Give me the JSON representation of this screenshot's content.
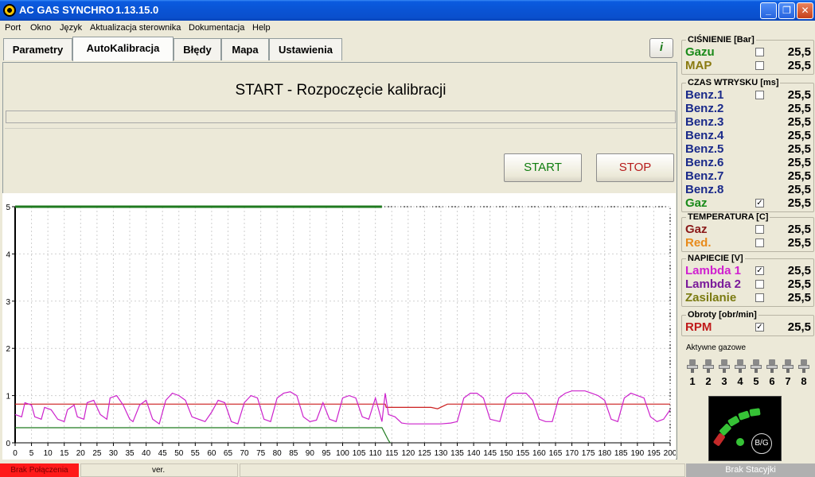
{
  "window": {
    "title": "AC GAS SYNCHRO",
    "version": "1.13.15.0"
  },
  "menu": [
    "Port",
    "Okno",
    "Język",
    "Aktualizacja sterownika",
    "Dokumentacja",
    "Help"
  ],
  "tabs": [
    "Parametry",
    "AutoKalibracja",
    "Błędy",
    "Mapa",
    "Ustawienia"
  ],
  "help_icon": "i",
  "calibration": {
    "title": "START - Rozpoczęcie kalibracji",
    "start": "START",
    "stop": "STOP",
    "progress": 0
  },
  "chart_data": {
    "type": "line",
    "x_ticks": [
      0,
      5,
      10,
      15,
      20,
      25,
      30,
      35,
      40,
      45,
      50,
      55,
      60,
      65,
      70,
      75,
      80,
      85,
      90,
      95,
      100,
      105,
      110,
      115,
      120,
      125,
      130,
      135,
      140,
      145,
      150,
      155,
      160,
      165,
      170,
      175,
      180,
      185,
      190,
      195,
      200
    ],
    "y_ticks": [
      0,
      1,
      2,
      3,
      4,
      5
    ],
    "xlim": [
      0,
      200
    ],
    "ylim": [
      0,
      5
    ],
    "grid": true,
    "series": [
      {
        "color": "#1f7a1f",
        "x": [
          0,
          112
        ],
        "y": [
          5.0,
          5.0
        ]
      },
      {
        "color": "#cc1f1f",
        "x": [
          0,
          113,
          113.3,
          127,
          129,
          132,
          200
        ],
        "y": [
          0.82,
          0.82,
          0.75,
          0.75,
          0.72,
          0.82,
          0.82
        ]
      },
      {
        "color": "#1f7a1f",
        "x": [
          0,
          112,
          114,
          114.5
        ],
        "y": [
          0.32,
          0.32,
          0.05,
          0.0
        ]
      },
      {
        "color": "#cc22cc",
        "x": [
          0,
          2,
          3,
          5,
          6,
          8,
          9,
          11,
          13,
          15,
          16,
          18,
          19,
          21,
          22,
          24,
          26,
          28,
          29,
          31,
          33,
          35,
          36,
          38,
          40,
          42,
          44,
          46,
          48,
          50,
          52,
          54,
          56,
          58,
          60,
          62,
          64,
          66,
          68,
          70,
          72,
          74,
          76,
          78,
          80,
          82,
          84,
          86,
          88,
          90,
          92,
          94,
          96,
          98,
          100,
          102,
          104,
          106,
          108,
          110,
          112,
          113,
          114,
          116,
          118,
          120,
          122,
          125,
          128,
          130,
          133,
          135,
          137,
          139,
          141,
          143,
          145,
          148,
          150,
          152,
          154,
          156,
          158,
          160,
          162,
          164,
          166,
          168,
          170,
          172,
          174,
          176,
          178,
          180,
          182,
          184,
          186,
          188,
          190,
          192,
          194,
          196,
          198,
          200
        ],
        "y": [
          0.6,
          0.55,
          0.85,
          0.8,
          0.55,
          0.5,
          0.75,
          0.7,
          0.5,
          0.45,
          0.7,
          0.8,
          0.55,
          0.5,
          0.85,
          0.9,
          0.6,
          0.5,
          0.95,
          1.0,
          0.8,
          0.5,
          0.45,
          0.8,
          0.9,
          0.5,
          0.4,
          0.9,
          1.05,
          1.0,
          0.9,
          0.55,
          0.5,
          0.45,
          0.65,
          0.9,
          0.85,
          0.45,
          0.4,
          0.85,
          1.0,
          0.95,
          0.5,
          0.45,
          0.95,
          1.05,
          1.08,
          1.0,
          0.55,
          0.45,
          0.48,
          0.85,
          0.5,
          0.45,
          0.95,
          1.0,
          0.95,
          0.55,
          0.5,
          0.95,
          0.45,
          1.05,
          0.6,
          0.55,
          0.42,
          0.4,
          0.4,
          0.4,
          0.4,
          0.4,
          0.42,
          0.45,
          0.95,
          1.05,
          1.05,
          0.95,
          0.5,
          0.45,
          0.95,
          1.05,
          1.05,
          1.05,
          0.9,
          0.5,
          0.45,
          0.45,
          0.95,
          1.05,
          1.1,
          1.1,
          1.1,
          1.05,
          1.0,
          0.9,
          0.5,
          0.45,
          0.95,
          1.05,
          1.0,
          0.95,
          0.55,
          0.45,
          0.5,
          0.7
        ]
      }
    ]
  },
  "side": {
    "cisnienie": {
      "title": "CIŚNIENIE [Bar]",
      "rows": [
        {
          "label": "Gazu",
          "color": "#1a8a1a",
          "checked": "",
          "value": "25,5"
        },
        {
          "label": "MAP",
          "color": "#8a7a10",
          "checked": "",
          "value": "25,5"
        }
      ]
    },
    "czas": {
      "title": "CZAS WTRYSKU [ms]",
      "rows": [
        {
          "label": "Benz.1",
          "color": "#1a2a8a",
          "checked": "",
          "value": "25,5"
        },
        {
          "label": "Benz.2",
          "color": "#1a2a8a",
          "value": "25,5"
        },
        {
          "label": "Benz.3",
          "color": "#1a2a8a",
          "value": "25,5"
        },
        {
          "label": "Benz.4",
          "color": "#1a2a8a",
          "value": "25,5"
        },
        {
          "label": "Benz.5",
          "color": "#1a2a8a",
          "value": "25,5"
        },
        {
          "label": "Benz.6",
          "color": "#1a2a8a",
          "value": "25,5"
        },
        {
          "label": "Benz.7",
          "color": "#1a2a8a",
          "value": "25,5"
        },
        {
          "label": "Benz.8",
          "color": "#1a2a8a",
          "value": "25,5"
        },
        {
          "label": "Gaz",
          "color": "#1a8a1a",
          "checked": "✓",
          "value": "25,5"
        }
      ]
    },
    "temperatura": {
      "title": "TEMPERATURA [C]",
      "rows": [
        {
          "label": "Gaz",
          "color": "#8a1a1a",
          "checked": "",
          "value": "25,5"
        },
        {
          "label": "Red.",
          "color": "#e88a1a",
          "checked": "",
          "value": "25,5"
        }
      ]
    },
    "napiecie": {
      "title": "NAPIECIE [V]",
      "rows": [
        {
          "label": "Lambda 1",
          "color": "#d020d0",
          "checked": "✓",
          "value": "25,5"
        },
        {
          "label": "Lambda 2",
          "color": "#7a1a9a",
          "checked": "",
          "value": "25,5"
        },
        {
          "label": "Zasilanie",
          "color": "#7a7a10",
          "checked": "",
          "value": "25,5"
        }
      ]
    },
    "obroty": {
      "title": "Obroty [obr/min]",
      "rows": [
        {
          "label": "RPM",
          "color": "#c01a1a",
          "checked": "✓",
          "value": "25,5"
        }
      ]
    },
    "aktywne": {
      "title": "Aktywne gazowe",
      "numbers": [
        "1",
        "2",
        "3",
        "4",
        "5",
        "6",
        "7",
        "8"
      ]
    },
    "gauge": {
      "button": "B/G"
    }
  },
  "status": {
    "connection": "Brak Połączenia",
    "ver": "ver.",
    "right": "Brak Stacyjki"
  }
}
